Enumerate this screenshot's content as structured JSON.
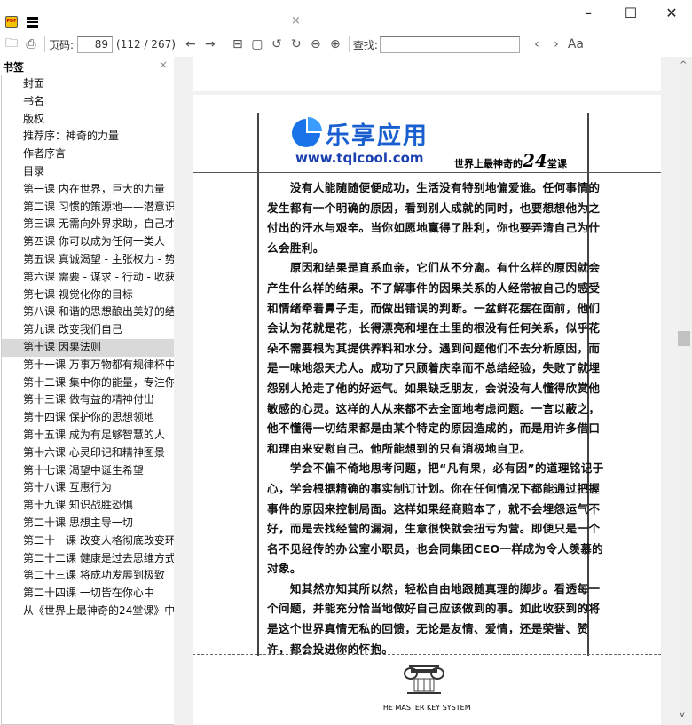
{
  "window": {
    "tab_close": "×",
    "minimize": "–",
    "maximize": "☐",
    "close": "✕",
    "app_icon_text": "PDF"
  },
  "toolbar": {
    "page_label": "页码:",
    "page_value": "89",
    "page_count": "(112 / 267)",
    "find_label": "查找:",
    "find_value": "",
    "match_case": "Aa",
    "icons": [
      "folder-icon",
      "print-icon",
      "back-icon",
      "forward-icon",
      "fit-page-icon",
      "single-page-icon",
      "rotate-left-icon",
      "rotate-right-icon",
      "zoom-out-icon",
      "zoom-in-icon",
      "find-prev-icon",
      "find-next-icon"
    ]
  },
  "sidebar": {
    "title": "书签",
    "close": "×",
    "selected_index": 15,
    "items": [
      "封面",
      "书名",
      "版权",
      "推荐序：神奇的力量",
      "作者序言",
      "目录",
      "第一课 内在世界，巨大的力量",
      "第二课 习惯的策源地——潜意识",
      "第三课 无需向外界求助，自己才",
      "第四课 你可以成为任何一类人",
      "第五课 真诚渴望 - 主张权力 - 势",
      "第六课 需要 - 谋求 - 行动 - 收获",
      "第七课 视觉化你的目标",
      "第八课 和谐的思想酿出美好的结",
      "第九课 改变我们自己",
      "第十课 因果法则",
      "第十一课 万事万物都有规律杯中",
      "第十二课 集中你的能量，专注你",
      "第十三课 做有益的精神付出",
      "第十四课 保护你的思想领地",
      "第十五课 成为有足够智慧的人",
      "第十六课 心灵印记和精神图景",
      "第十七课 渴望中诞生希望",
      "第十八课 互惠行为",
      "第十九课 知识战胜恐惧",
      "第二十课 思想主导一切",
      "第二十一课 改变人格彻底改变环",
      "第二十二课 健康是过去思维方式",
      "第二十三课 将成功发展到极致",
      "第二十四课 一切皆在你心中",
      "从《世界上最神奇的24堂课》中"
    ]
  },
  "page": {
    "logo_cn": "乐享应用",
    "logo_url": "www.tqlcool.com",
    "logo_color": "#1a5fd0",
    "running_head": "世界上最神奇的",
    "running_head_num": "24",
    "running_head_end": "堂课",
    "lines": [
      "　　没有人能随随便便成功，生活没有特别地偏爱谁。任何事情的",
      "发生都有一个明确的原因，看到别人成就的同时，也要想想他为之",
      "付出的汗水与艰辛。当你如愿地赢得了胜利，你也要弄清自己为什",
      "么会胜利。",
      "　　原因和结果是直系血亲，它们从不分离。有什么样的原因就会",
      "产生什么样的结果。不了解事件的因果关系的人经常被自己的感受",
      "和情绪牵着鼻子走，而做出错误的判断。一盆鲜花摆在面前，他们",
      "会认为花就是花，长得漂亮和埋在土里的根没有任何关系，似乎花",
      "朵不需要根为其提供养料和水分。遇到问题他们不去分析原因，而",
      "是一味地怨天尤人。成功了只顾着庆幸而不总结经验，失败了就埋",
      "怨别人抢走了他的好运气。如果缺乏朋友，会说没有人懂得欣赏他",
      "敏感的心灵。这样的人从来都不去全面地考虑问题。一言以蔽之，",
      "他不懂得一切结果都是由某个特定的原因造成的，而是用许多借口",
      "和理由来安慰自己。他所能想到的只有消极地自卫。",
      "　　学会不偏不倚地思考问题，把“凡有果，必有因”的道理铭记于",
      "心，学会根据精确的事实制订计划。你在任何情况下都能通过把握",
      "事件的原因来控制局面。这样如果经商赔本了，就不会埋怨运气不",
      "好，而是去找经营的漏洞，生意很快就会扭亏为营。即便只是一个",
      "名不见经传的办公室小职员，也会同集团CEO一样成为令人羡慕的",
      "对象。",
      "　　知其然亦知其所以然，轻松自由地跟随真理的脚步。看透每一",
      "个问题，并能充分恰当地做好自己应该做到的事。如此收获到的将",
      "是这个世界真情无私的回馈，无论是友情、爱情，还是荣誉、赞",
      "许，都会投进你的怀抱。"
    ],
    "footer": "THE MASTER KEY SYSTEM"
  },
  "scrollbar": {
    "up": "^",
    "down": "v"
  }
}
